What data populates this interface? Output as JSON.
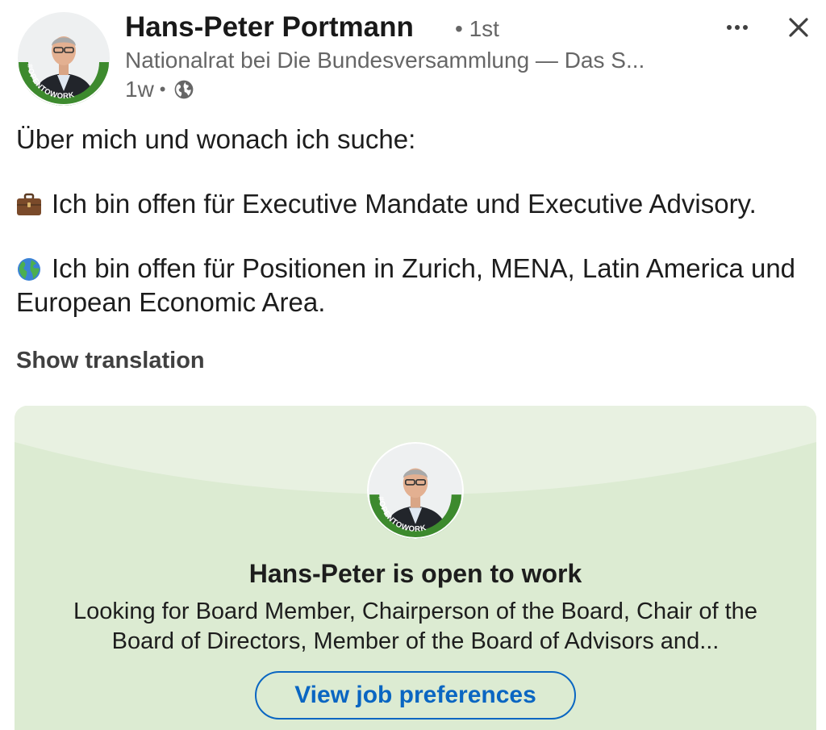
{
  "post": {
    "author": {
      "name": "Hans-Peter Portmann",
      "connection_degree": "1st",
      "headline": "Nationalrat bei Die Bundesversammlung — Das S...",
      "time_ago": "1w",
      "visibility_icon": "globe-icon",
      "badge": "#OPENTOWORK"
    },
    "actions": {
      "more_icon": "more-icon",
      "close_icon": "close-icon"
    },
    "text": {
      "intro": "Über mich und wonach ich suche:",
      "line1_emoji": "briefcase",
      "line1": "Ich bin offen für Executive Mandate und Executive Advisory.",
      "line2_emoji": "globe-americas",
      "line2": "Ich bin offen für Positionen in Zurich, MENA, Latin America und European Economic Area."
    },
    "show_translation": "Show translation"
  },
  "open_to_work_card": {
    "badge": "#OPENTOWORK",
    "title": "Hans-Peter is open to work",
    "description": "Looking for Board Member, Chairperson of the Board, Chair of the Board of Directors, Member of the Board of Advisors and...",
    "button": "View job preferences"
  },
  "colors": {
    "accent_blue": "#0a66c2",
    "open_to_work_green": "#3d8a2e",
    "card_background": "#dcebd2",
    "secondary_text": "#666666"
  }
}
